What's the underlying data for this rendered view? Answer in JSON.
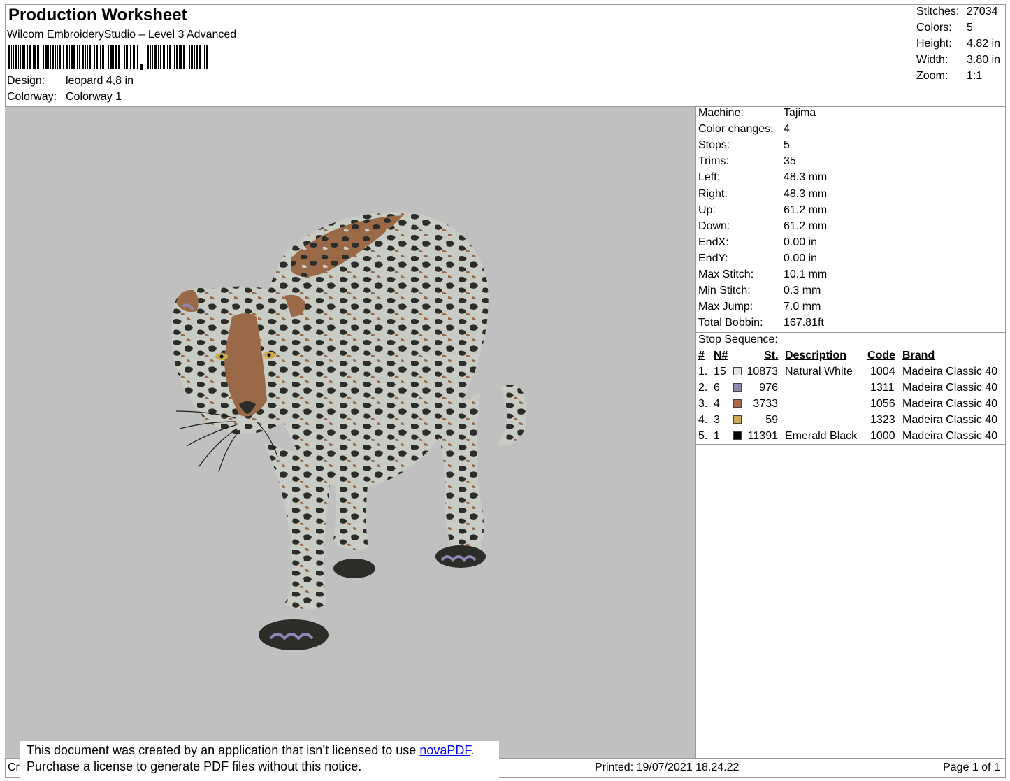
{
  "header": {
    "title": "Production Worksheet",
    "software": "Wilcom EmbroideryStudio – Level 3 Advanced",
    "design_label": "Design:",
    "design_value": "leopard 4,8 in",
    "colorway_label": "Colorway:",
    "colorway_value": "Colorway 1"
  },
  "summary": [
    {
      "label": "Stitches:",
      "value": "27034"
    },
    {
      "label": "Colors:",
      "value": "5"
    },
    {
      "label": "Height:",
      "value": "4.82 in"
    },
    {
      "label": "Width:",
      "value": "3.80 in"
    },
    {
      "label": "Zoom:",
      "value": "1:1"
    }
  ],
  "machine_info": [
    {
      "label": "Machine:",
      "value": "Tajima"
    },
    {
      "label": "Color changes:",
      "value": "4"
    },
    {
      "label": "Stops:",
      "value": "5"
    },
    {
      "label": "Trims:",
      "value": "35"
    },
    {
      "label": "Left:",
      "value": "48.3 mm"
    },
    {
      "label": "Right:",
      "value": "48.3 mm"
    },
    {
      "label": "Up:",
      "value": "61.2 mm"
    },
    {
      "label": "Down:",
      "value": "61.2 mm"
    },
    {
      "label": "EndX:",
      "value": "0.00 in"
    },
    {
      "label": "EndY:",
      "value": "0.00 in"
    },
    {
      "label": "Max Stitch:",
      "value": "10.1 mm"
    },
    {
      "label": "Min Stitch:",
      "value": "0.3 mm"
    },
    {
      "label": "Max Jump:",
      "value": "7.0 mm"
    },
    {
      "label": "Total Bobbin:",
      "value": "167.81ft"
    }
  ],
  "stop_sequence": {
    "title": "Stop Sequence:",
    "headers": {
      "num": "#",
      "needle": "N#",
      "stitches": "St.",
      "description": "Description",
      "code": "Code",
      "brand": "Brand"
    },
    "rows": [
      {
        "num": "1.",
        "needle": "15",
        "color": "#e4e4e0",
        "stitches": "10873",
        "description": "Natural White",
        "code": "1004",
        "brand": "Madeira Classic 40"
      },
      {
        "num": "2.",
        "needle": "6",
        "color": "#8c88b4",
        "stitches": "976",
        "description": "",
        "code": "1311",
        "brand": "Madeira Classic 40"
      },
      {
        "num": "3.",
        "needle": "4",
        "color": "#a8684a",
        "stitches": "3733",
        "description": "",
        "code": "1056",
        "brand": "Madeira Classic 40"
      },
      {
        "num": "4.",
        "needle": "3",
        "color": "#ccaa50",
        "stitches": "59",
        "description": "",
        "code": "1323",
        "brand": "Madeira Classic 40"
      },
      {
        "num": "5.",
        "needle": "1",
        "color": "#000000",
        "stitches": "11391",
        "description": "Emerald Black",
        "code": "1000",
        "brand": "Madeira Classic 40"
      }
    ]
  },
  "notice": {
    "line1_prefix": "This document was created by an application that isn’t licensed to use ",
    "link": "novaPDF",
    "line1_suffix": ".",
    "line2": "Purchase a license to generate PDF files without this notice."
  },
  "footer": {
    "left_fragment": "Cr",
    "printed": "Printed: 19/07/2021 18.24.22",
    "page": "Page 1 of 1"
  },
  "design_colors": {
    "canvas": "#c0c0c0",
    "fur_light": "#c9ccc4",
    "fur_brown": "#9a6a48",
    "fur_dark": "#2c2c28",
    "paw_blue": "#8c88b4",
    "eye_gold": "#ccaa50"
  }
}
